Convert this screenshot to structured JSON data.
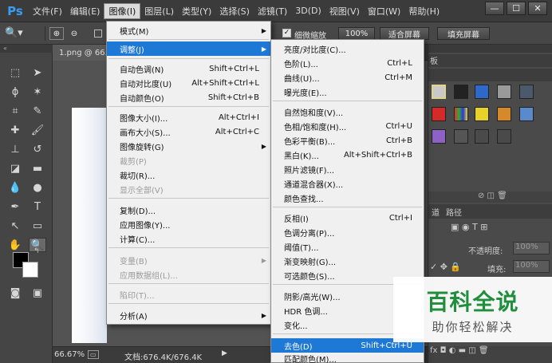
{
  "app": {
    "logo": "Ps"
  },
  "menubar": {
    "items": [
      "文件(F)",
      "编辑(E)",
      "图像(I)",
      "图层(L)",
      "类型(Y)",
      "选择(S)",
      "滤镜(T)",
      "3D(D)",
      "视图(V)",
      "窗口(W)",
      "帮助(H)"
    ],
    "active": "图像(I)"
  },
  "window_controls": {
    "minimize": "—",
    "restore": "☐",
    "close": "✕"
  },
  "options_bar": {
    "checkbox_label": "细微缩放",
    "zoom_btn": "100%",
    "fit_btn": "适合屏幕",
    "fill_btn": "填充屏幕"
  },
  "document": {
    "tab": "1.png @ 66."
  },
  "status_bar": {
    "zoom": "66.67%",
    "doc_info": "文档:676.4K/676.4K"
  },
  "right_panel": {
    "top_tab": "板",
    "tabs": [
      "道",
      "路径"
    ],
    "opacity_label": "不透明度:",
    "opacity_value": "100%",
    "fill_label": "填充:",
    "fill_value": "100%"
  },
  "image_menu": {
    "items": [
      {
        "label": "模式(M)",
        "submenu": true
      },
      {
        "label": "调整(J)",
        "submenu": true,
        "highlighted": true
      },
      {
        "label": "自动色调(N)",
        "shortcut": "Shift+Ctrl+L"
      },
      {
        "label": "自动对比度(U)",
        "shortcut": "Alt+Shift+Ctrl+L"
      },
      {
        "label": "自动颜色(O)",
        "shortcut": "Shift+Ctrl+B"
      },
      {
        "label": "图像大小(I)...",
        "shortcut": "Alt+Ctrl+I"
      },
      {
        "label": "画布大小(S)...",
        "shortcut": "Alt+Ctrl+C"
      },
      {
        "label": "图像旋转(G)",
        "submenu": true
      },
      {
        "label": "裁剪(P)",
        "disabled": true
      },
      {
        "label": "裁切(R)..."
      },
      {
        "label": "显示全部(V)",
        "disabled": true
      },
      {
        "label": "复制(D)..."
      },
      {
        "label": "应用图像(Y)..."
      },
      {
        "label": "计算(C)..."
      },
      {
        "label": "变量(B)",
        "submenu": true,
        "disabled": true
      },
      {
        "label": "应用数据组(L)...",
        "disabled": true
      },
      {
        "label": "陷印(T)...",
        "disabled": true
      },
      {
        "label": "分析(A)",
        "submenu": true
      }
    ]
  },
  "adjust_menu": {
    "items": [
      {
        "label": "亮度/对比度(C)..."
      },
      {
        "label": "色阶(L)...",
        "shortcut": "Ctrl+L"
      },
      {
        "label": "曲线(U)...",
        "shortcut": "Ctrl+M"
      },
      {
        "label": "曝光度(E)..."
      },
      {
        "label": "自然饱和度(V)..."
      },
      {
        "label": "色相/饱和度(H)...",
        "shortcut": "Ctrl+U"
      },
      {
        "label": "色彩平衡(B)...",
        "shortcut": "Ctrl+B"
      },
      {
        "label": "黑白(K)...",
        "shortcut": "Alt+Shift+Ctrl+B"
      },
      {
        "label": "照片滤镜(F)..."
      },
      {
        "label": "通道混合器(X)..."
      },
      {
        "label": "颜色查找..."
      },
      {
        "label": "反相(I)",
        "shortcut": "Ctrl+I"
      },
      {
        "label": "色调分离(P)..."
      },
      {
        "label": "阈值(T)..."
      },
      {
        "label": "渐变映射(G)..."
      },
      {
        "label": "可选颜色(S)..."
      },
      {
        "label": "阴影/高光(W)..."
      },
      {
        "label": "HDR 色调..."
      },
      {
        "label": "变化..."
      },
      {
        "label": "去色(D)",
        "shortcut": "Shift+Ctrl+U",
        "highlighted": true
      },
      {
        "label": "匹配颜色(M)..."
      }
    ]
  },
  "watermark": {
    "title": "百科全说",
    "subtitle": "助你轻松解决"
  },
  "colors": {
    "accent": "#1e78d6",
    "menu_bg": "#f0f0f0",
    "ui_dark": "#3b3b3b",
    "watermark_green": "#1f8f3d"
  }
}
